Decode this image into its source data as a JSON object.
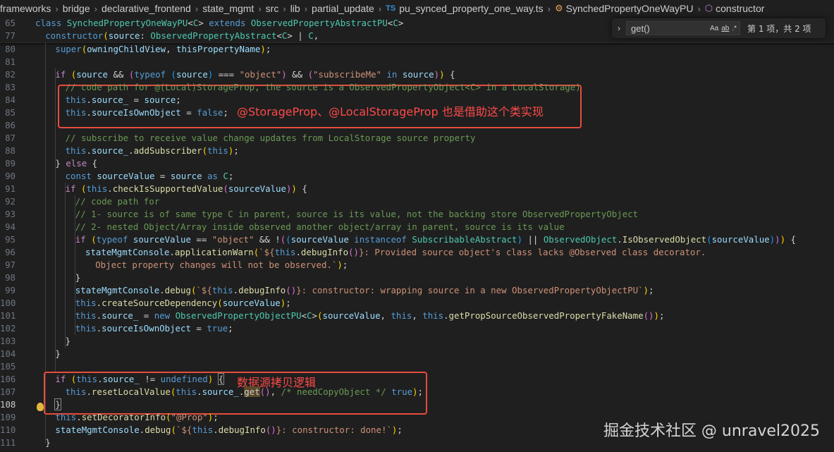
{
  "breadcrumb": {
    "items": [
      "frameworks",
      "bridge",
      "declarative_frontend",
      "state_mgmt",
      "src",
      "lib",
      "partial_update"
    ],
    "file_badge": "TS",
    "file": "pu_synced_property_one_way.ts",
    "class_name": "SynchedPropertyOneWayPU",
    "member": "constructor"
  },
  "find": {
    "query": "get()",
    "opt_case": "Aa",
    "opt_word": "ab",
    "opt_regex": ".*",
    "result": "第 1 项，共 2 项"
  },
  "annotations": {
    "storage": "@StorageProp、@LocalStorageProp 也是借助这个类实现",
    "copy": "数据源拷贝逻辑"
  },
  "watermark": "掘金技术社区 @ unravel2025",
  "lines": [
    {
      "n": "65",
      "indent": 0,
      "t": [
        [
          "kw",
          "class "
        ],
        [
          "typ",
          "SynchedPropertyOneWayPU"
        ],
        [
          "pl",
          "<"
        ],
        [
          "typ",
          "C"
        ],
        [
          "pl",
          "> "
        ],
        [
          "kw",
          "extends "
        ],
        [
          "typ",
          "ObservedPropertyAbstractPU"
        ],
        [
          "pl",
          "<"
        ],
        [
          "typ",
          "C"
        ],
        [
          "pl",
          ">"
        ]
      ]
    },
    {
      "n": "77",
      "indent": 1,
      "t": [
        [
          "kw",
          "constructor"
        ],
        [
          "br1",
          "("
        ],
        [
          "var",
          "source"
        ],
        [
          "pl",
          ": "
        ],
        [
          "typ",
          "ObservedPropertyAbstract"
        ],
        [
          "pl",
          "<"
        ],
        [
          "typ",
          "C"
        ],
        [
          "pl",
          "> | "
        ],
        [
          "typ",
          "C"
        ],
        [
          "pl",
          ","
        ]
      ]
    },
    {
      "n": "80",
      "indent": 2,
      "t": [
        [
          "kw",
          "super"
        ],
        [
          "br1",
          "("
        ],
        [
          "var",
          "owningChildView"
        ],
        [
          "pl",
          ", "
        ],
        [
          "var",
          "thisPropertyName"
        ],
        [
          "br1",
          ")"
        ],
        [
          "pl",
          ";"
        ]
      ]
    },
    {
      "n": "81",
      "indent": 0,
      "t": []
    },
    {
      "n": "82",
      "indent": 2,
      "t": [
        [
          "ctl",
          "if "
        ],
        [
          "br1",
          "("
        ],
        [
          "var",
          "source"
        ],
        [
          "pl",
          " && "
        ],
        [
          "br2",
          "("
        ],
        [
          "kw",
          "typeof "
        ],
        [
          "br3",
          "("
        ],
        [
          "var",
          "source"
        ],
        [
          "br3",
          ")"
        ],
        [
          "pl",
          " === "
        ],
        [
          "str",
          "\"object\""
        ],
        [
          "br2",
          ")"
        ],
        [
          "pl",
          " && "
        ],
        [
          "br2",
          "("
        ],
        [
          "str",
          "\"subscribeMe\""
        ],
        [
          "kw",
          " in "
        ],
        [
          "var",
          "source"
        ],
        [
          "br2",
          ")"
        ],
        [
          "br1",
          ")"
        ],
        [
          "pl",
          " {"
        ]
      ]
    },
    {
      "n": "83",
      "indent": 3,
      "t": [
        [
          "com",
          "// code path for @(Local)StorageProp, the source is a ObservedPropertyObject<C> in a LocalStorage)"
        ]
      ]
    },
    {
      "n": "84",
      "indent": 3,
      "t": [
        [
          "kw",
          "this"
        ],
        [
          "pl",
          "."
        ],
        [
          "var",
          "source_"
        ],
        [
          "pl",
          " = "
        ],
        [
          "var",
          "source"
        ],
        [
          "pl",
          ";"
        ]
      ]
    },
    {
      "n": "85",
      "indent": 3,
      "t": [
        [
          "kw",
          "this"
        ],
        [
          "pl",
          "."
        ],
        [
          "var",
          "sourceIsOwnObject"
        ],
        [
          "pl",
          " = "
        ],
        [
          "kw",
          "false"
        ],
        [
          "pl",
          ";"
        ]
      ]
    },
    {
      "n": "86",
      "indent": 0,
      "t": []
    },
    {
      "n": "87",
      "indent": 3,
      "t": [
        [
          "com",
          "// subscribe to receive value change updates from LocalStorage source property"
        ]
      ]
    },
    {
      "n": "88",
      "indent": 3,
      "t": [
        [
          "kw",
          "this"
        ],
        [
          "pl",
          "."
        ],
        [
          "var",
          "source_"
        ],
        [
          "pl",
          "."
        ],
        [
          "fn",
          "addSubscriber"
        ],
        [
          "br1",
          "("
        ],
        [
          "kw",
          "this"
        ],
        [
          "br1",
          ")"
        ],
        [
          "pl",
          ";"
        ]
      ]
    },
    {
      "n": "89",
      "indent": 2,
      "t": [
        [
          "pl",
          "} "
        ],
        [
          "ctl",
          "else"
        ],
        [
          "pl",
          " {"
        ]
      ]
    },
    {
      "n": "90",
      "indent": 3,
      "t": [
        [
          "kw",
          "const "
        ],
        [
          "var",
          "sourceValue"
        ],
        [
          "pl",
          " = "
        ],
        [
          "var",
          "source"
        ],
        [
          "kw",
          " as "
        ],
        [
          "typ",
          "C"
        ],
        [
          "pl",
          ";"
        ]
      ]
    },
    {
      "n": "91",
      "indent": 3,
      "t": [
        [
          "ctl",
          "if "
        ],
        [
          "br1",
          "("
        ],
        [
          "kw",
          "this"
        ],
        [
          "pl",
          "."
        ],
        [
          "fn",
          "checkIsSupportedValue"
        ],
        [
          "br2",
          "("
        ],
        [
          "var",
          "sourceValue"
        ],
        [
          "br2",
          ")"
        ],
        [
          "br1",
          ")"
        ],
        [
          "pl",
          " {"
        ]
      ]
    },
    {
      "n": "92",
      "indent": 4,
      "t": [
        [
          "com",
          "// code path for"
        ]
      ]
    },
    {
      "n": "93",
      "indent": 4,
      "t": [
        [
          "com",
          "// 1- source is of same type C in parent, source is its value, not the backing store ObservedPropertyObject"
        ]
      ]
    },
    {
      "n": "94",
      "indent": 4,
      "t": [
        [
          "com",
          "// 2- nested Object/Array inside observed another object/array in parent, source is its value"
        ]
      ]
    },
    {
      "n": "95",
      "indent": 4,
      "t": [
        [
          "ctl",
          "if "
        ],
        [
          "br1",
          "("
        ],
        [
          "kw",
          "typeof "
        ],
        [
          "var",
          "sourceValue"
        ],
        [
          "pl",
          " == "
        ],
        [
          "str",
          "\"object\""
        ],
        [
          "pl",
          " && !"
        ],
        [
          "br2",
          "("
        ],
        [
          "br3",
          "("
        ],
        [
          "var",
          "sourceValue"
        ],
        [
          "kw",
          " instanceof "
        ],
        [
          "typ",
          "SubscribableAbstract"
        ],
        [
          "br3",
          ")"
        ],
        [
          "pl",
          " || "
        ],
        [
          "typ",
          "ObservedObject"
        ],
        [
          "pl",
          "."
        ],
        [
          "fn",
          "IsObservedObject"
        ],
        [
          "br3",
          "("
        ],
        [
          "var",
          "sourceValue"
        ],
        [
          "br3",
          ")"
        ],
        [
          "br2",
          ")"
        ],
        [
          "br1",
          ")"
        ],
        [
          "pl",
          " {"
        ]
      ]
    },
    {
      "n": "96",
      "indent": 5,
      "t": [
        [
          "var",
          "stateMgmtConsole"
        ],
        [
          "pl",
          "."
        ],
        [
          "fn",
          "applicationWarn"
        ],
        [
          "br1",
          "("
        ],
        [
          "str",
          "`${"
        ],
        [
          "kw",
          "this"
        ],
        [
          "pl",
          "."
        ],
        [
          "fn",
          "debugInfo"
        ],
        [
          "br2",
          "()"
        ],
        [
          "str",
          "}: Provided source object's class lacks @Observed class decorator."
        ]
      ]
    },
    {
      "n": "97",
      "indent": 6,
      "t": [
        [
          "str",
          "Object property changes will not be observed.`"
        ],
        [
          "br1",
          ")"
        ],
        [
          "pl",
          ";"
        ]
      ]
    },
    {
      "n": "98",
      "indent": 4,
      "t": [
        [
          "pl",
          "}"
        ]
      ]
    },
    {
      "n": "99",
      "indent": 4,
      "t": [
        [
          "var",
          "stateMgmtConsole"
        ],
        [
          "pl",
          "."
        ],
        [
          "fn",
          "debug"
        ],
        [
          "br1",
          "("
        ],
        [
          "str",
          "`${"
        ],
        [
          "kw",
          "this"
        ],
        [
          "pl",
          "."
        ],
        [
          "fn",
          "debugInfo"
        ],
        [
          "br2",
          "()"
        ],
        [
          "str",
          "}: constructor: wrapping source in a new ObservedPropertyObjectPU`"
        ],
        [
          "br1",
          ")"
        ],
        [
          "pl",
          ";"
        ]
      ]
    },
    {
      "n": "100",
      "indent": 4,
      "t": [
        [
          "kw",
          "this"
        ],
        [
          "pl",
          "."
        ],
        [
          "fn",
          "createSourceDependency"
        ],
        [
          "br1",
          "("
        ],
        [
          "var",
          "sourceValue"
        ],
        [
          "br1",
          ")"
        ],
        [
          "pl",
          ";"
        ]
      ]
    },
    {
      "n": "101",
      "indent": 4,
      "t": [
        [
          "kw",
          "this"
        ],
        [
          "pl",
          "."
        ],
        [
          "var",
          "source_"
        ],
        [
          "pl",
          " = "
        ],
        [
          "kw",
          "new "
        ],
        [
          "typ",
          "ObservedPropertyObjectPU"
        ],
        [
          "pl",
          "<"
        ],
        [
          "typ",
          "C"
        ],
        [
          "pl",
          ">"
        ],
        [
          "br1",
          "("
        ],
        [
          "var",
          "sourceValue"
        ],
        [
          "pl",
          ", "
        ],
        [
          "kw",
          "this"
        ],
        [
          "pl",
          ", "
        ],
        [
          "kw",
          "this"
        ],
        [
          "pl",
          "."
        ],
        [
          "fn",
          "getPropSourceObservedPropertyFakeName"
        ],
        [
          "br2",
          "()"
        ],
        [
          "br1",
          ")"
        ],
        [
          "pl",
          ";"
        ]
      ]
    },
    {
      "n": "102",
      "indent": 4,
      "t": [
        [
          "kw",
          "this"
        ],
        [
          "pl",
          "."
        ],
        [
          "var",
          "sourceIsOwnObject"
        ],
        [
          "pl",
          " = "
        ],
        [
          "kw",
          "true"
        ],
        [
          "pl",
          ";"
        ]
      ]
    },
    {
      "n": "103",
      "indent": 3,
      "t": [
        [
          "pl",
          "}"
        ]
      ]
    },
    {
      "n": "104",
      "indent": 2,
      "t": [
        [
          "pl",
          "}"
        ]
      ]
    },
    {
      "n": "105",
      "indent": 0,
      "t": []
    },
    {
      "n": "106",
      "indent": 2,
      "t": [
        [
          "ctl",
          "if "
        ],
        [
          "br1",
          "("
        ],
        [
          "kw",
          "this"
        ],
        [
          "pl",
          "."
        ],
        [
          "var",
          "source_"
        ],
        [
          "pl",
          " != "
        ],
        [
          "kw",
          "undefined"
        ],
        [
          "br1",
          ")"
        ],
        [
          "pl",
          " "
        ],
        [
          "bx",
          "{"
        ]
      ]
    },
    {
      "n": "107",
      "indent": 3,
      "t": [
        [
          "kw",
          "this"
        ],
        [
          "pl",
          "."
        ],
        [
          "fn",
          "resetLocalValue"
        ],
        [
          "br1",
          "("
        ],
        [
          "kw",
          "this"
        ],
        [
          "pl",
          "."
        ],
        [
          "var",
          "source_"
        ],
        [
          "pl",
          "."
        ],
        [
          "hl",
          "get"
        ],
        [
          "br2",
          "()"
        ],
        [
          "pl",
          ", "
        ],
        [
          "com",
          "/* needCopyObject */"
        ],
        [
          "pl",
          " "
        ],
        [
          "kw",
          "true"
        ],
        [
          "br1",
          ")"
        ],
        [
          "pl",
          ";"
        ]
      ]
    },
    {
      "n": "108",
      "indent": 2,
      "t": [
        [
          "bx",
          "}"
        ]
      ]
    },
    {
      "n": "109",
      "indent": 2,
      "t": [
        [
          "kw",
          "this"
        ],
        [
          "pl",
          "."
        ],
        [
          "fn",
          "setDecoratorInfo"
        ],
        [
          "br1",
          "("
        ],
        [
          "str",
          "\"@Prop\""
        ],
        [
          "br1",
          ")"
        ],
        [
          "pl",
          ";"
        ]
      ]
    },
    {
      "n": "110",
      "indent": 2,
      "t": [
        [
          "var",
          "stateMgmtConsole"
        ],
        [
          "pl",
          "."
        ],
        [
          "fn",
          "debug"
        ],
        [
          "br1",
          "("
        ],
        [
          "str",
          "`${"
        ],
        [
          "kw",
          "this"
        ],
        [
          "pl",
          "."
        ],
        [
          "fn",
          "debugInfo"
        ],
        [
          "br2",
          "()"
        ],
        [
          "str",
          "}: constructor: done!`"
        ],
        [
          "br1",
          ")"
        ],
        [
          "pl",
          ";"
        ]
      ]
    },
    {
      "n": "111",
      "indent": 1,
      "t": [
        [
          "pl",
          "}"
        ]
      ]
    }
  ]
}
